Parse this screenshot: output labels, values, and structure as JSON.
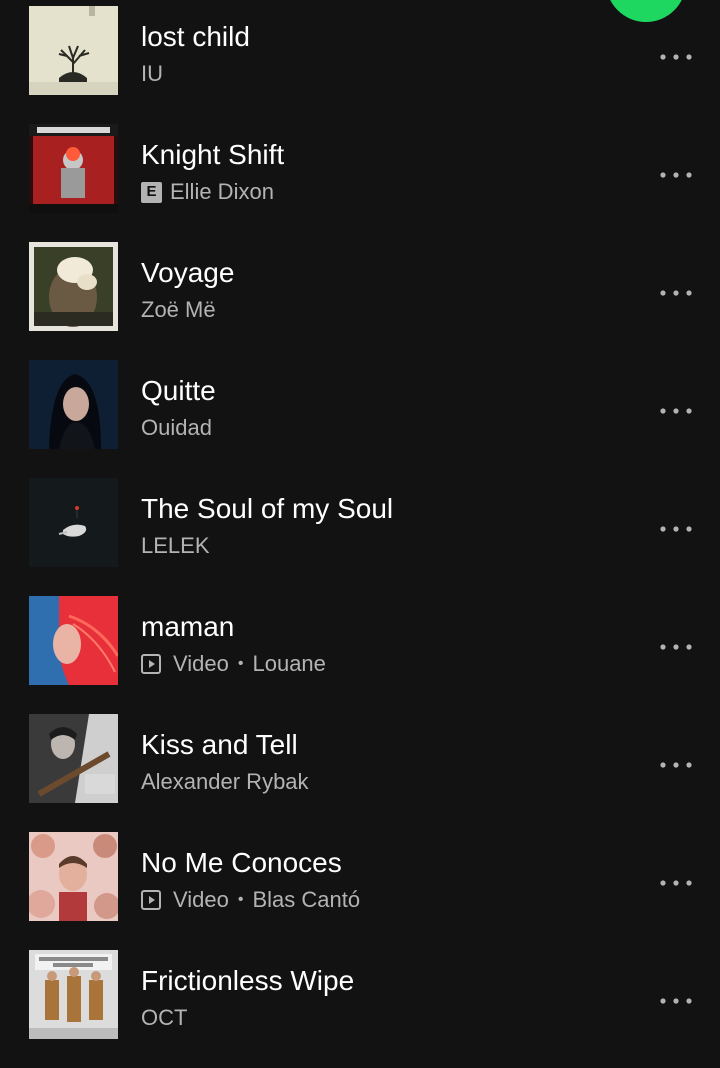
{
  "tracks": [
    {
      "title": "lost child",
      "artist": "IU",
      "explicit": false,
      "video": false,
      "video_label": ""
    },
    {
      "title": "Knight Shift",
      "artist": "Ellie Dixon",
      "explicit": true,
      "explicit_label": "E",
      "video": false,
      "video_label": ""
    },
    {
      "title": "Voyage",
      "artist": "Zoë Më",
      "explicit": false,
      "video": false,
      "video_label": ""
    },
    {
      "title": "Quitte",
      "artist": "Ouidad",
      "explicit": false,
      "video": false,
      "video_label": ""
    },
    {
      "title": "The Soul of my Soul",
      "artist": "LELEK",
      "explicit": false,
      "video": false,
      "video_label": ""
    },
    {
      "title": "maman",
      "artist": "Louane",
      "explicit": false,
      "video": true,
      "video_label": "Video"
    },
    {
      "title": "Kiss and Tell",
      "artist": "Alexander Rybak",
      "explicit": false,
      "video": false,
      "video_label": ""
    },
    {
      "title": "No Me Conoces",
      "artist": "Blas Cantó",
      "explicit": false,
      "video": true,
      "video_label": "Video"
    },
    {
      "title": "Frictionless Wipe",
      "artist": "OCT",
      "explicit": false,
      "video": false,
      "video_label": ""
    }
  ],
  "separator": "•",
  "colors": {
    "background": "#121212",
    "title": "#ffffff",
    "subtitle": "#b3b3b3",
    "accent": "#1ed760"
  },
  "icons": {
    "more": "more-options-icon",
    "video": "video-icon",
    "play": "play-button"
  }
}
